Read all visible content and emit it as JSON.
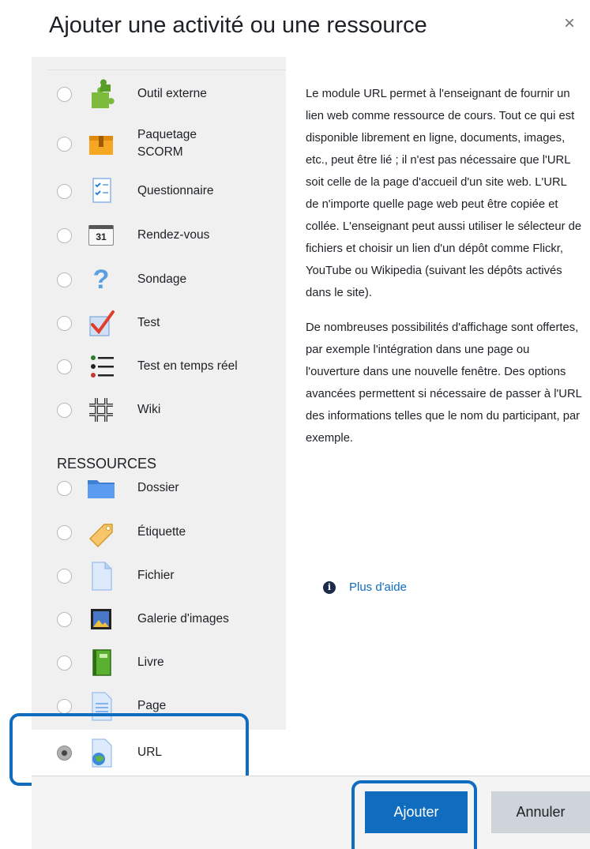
{
  "dialog": {
    "title": "Ajouter une activité ou une ressource",
    "close_glyph": "×"
  },
  "activities": [
    {
      "label": "Outil externe",
      "icon": "puzzle-icon"
    },
    {
      "label": "Paquetage SCORM",
      "icon": "package-icon"
    },
    {
      "label": "Questionnaire",
      "icon": "checklist-icon"
    },
    {
      "label": "Rendez-vous",
      "icon": "calendar-icon",
      "icon_text": "31"
    },
    {
      "label": "Sondage",
      "icon": "question-mark-icon",
      "icon_text": "?"
    },
    {
      "label": "Test",
      "icon": "checkmark-icon"
    },
    {
      "label": "Test en temps réel",
      "icon": "list-icon"
    },
    {
      "label": "Wiki",
      "icon": "knot-icon"
    }
  ],
  "resources_section": {
    "title": "RESSOURCES"
  },
  "resources": [
    {
      "label": "Dossier",
      "icon": "folder-icon"
    },
    {
      "label": "Étiquette",
      "icon": "label-tag-icon"
    },
    {
      "label": "Fichier",
      "icon": "file-icon"
    },
    {
      "label": "Galerie d'images",
      "icon": "image-gallery-icon"
    },
    {
      "label": "Livre",
      "icon": "book-icon"
    },
    {
      "label": "Page",
      "icon": "page-icon"
    },
    {
      "label": "URL",
      "icon": "url-globe-icon",
      "selected": true
    }
  ],
  "description": {
    "paragraph1": "Le module URL permet à l'enseignant de fournir un lien web comme ressource de cours. Tout ce qui est disponible librement en ligne, documents, images, etc., peut être lié ; il n'est pas nécessaire que l'URL soit celle de la page d'accueil d'un site web. L'URL de n'importe quelle page web peut être copiée et collée. L'enseignant peut aussi utiliser le sélecteur de fichiers et choisir un lien d'un dépôt comme Flickr, YouTube ou Wikipedia (suivant les dépôts activés dans le site).",
    "paragraph2": "De nombreuses possibilités d'affichage sont offertes, par exemple l'intégration dans une page ou l'ouverture dans une nouvelle fenêtre. Des options avancées permettent si nécessaire de passer à l'URL des informations telles que le nom du participant, par exemple.",
    "help_icon_glyph": "i",
    "help_link": "Plus d'aide"
  },
  "footer": {
    "add_label": "Ajouter",
    "cancel_label": "Annuler"
  },
  "colors": {
    "accent": "#0f6cbf",
    "list_background": "#f0f0f0",
    "cancel_background": "#ced4da"
  }
}
